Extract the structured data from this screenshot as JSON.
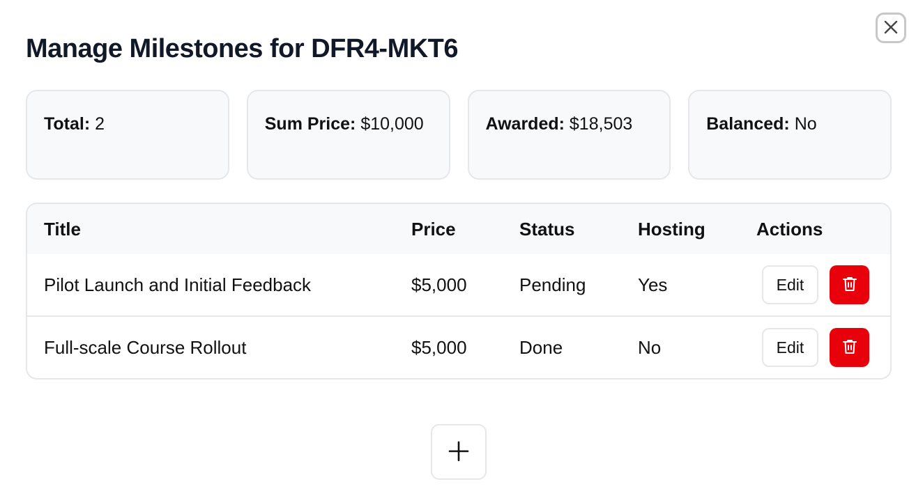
{
  "header": {
    "title": "Manage Milestones for DFR4-MKT6",
    "close_icon": "close-icon"
  },
  "stats": [
    {
      "label": "Total:",
      "value": "2"
    },
    {
      "label": "Sum Price:",
      "value": "$10,000"
    },
    {
      "label": "Awarded:",
      "value": "$18,503"
    },
    {
      "label": "Balanced:",
      "value": "No"
    }
  ],
  "table": {
    "columns": [
      "Title",
      "Price",
      "Status",
      "Hosting",
      "Actions"
    ],
    "rows": [
      {
        "title": "Pilot Launch and Initial Feedback",
        "price": "$5,000",
        "status": "Pending",
        "hosting": "Yes",
        "edit_label": "Edit",
        "delete_icon": "trash-icon"
      },
      {
        "title": "Full-scale Course Rollout",
        "price": "$5,000",
        "status": "Done",
        "hosting": "No",
        "edit_label": "Edit",
        "delete_icon": "trash-icon"
      }
    ]
  },
  "add_button": {
    "icon": "plus-icon"
  },
  "colors": {
    "delete": "#e8000b",
    "border": "#e5e7eb",
    "card_bg": "#f8f9fb",
    "title": "#111827"
  }
}
